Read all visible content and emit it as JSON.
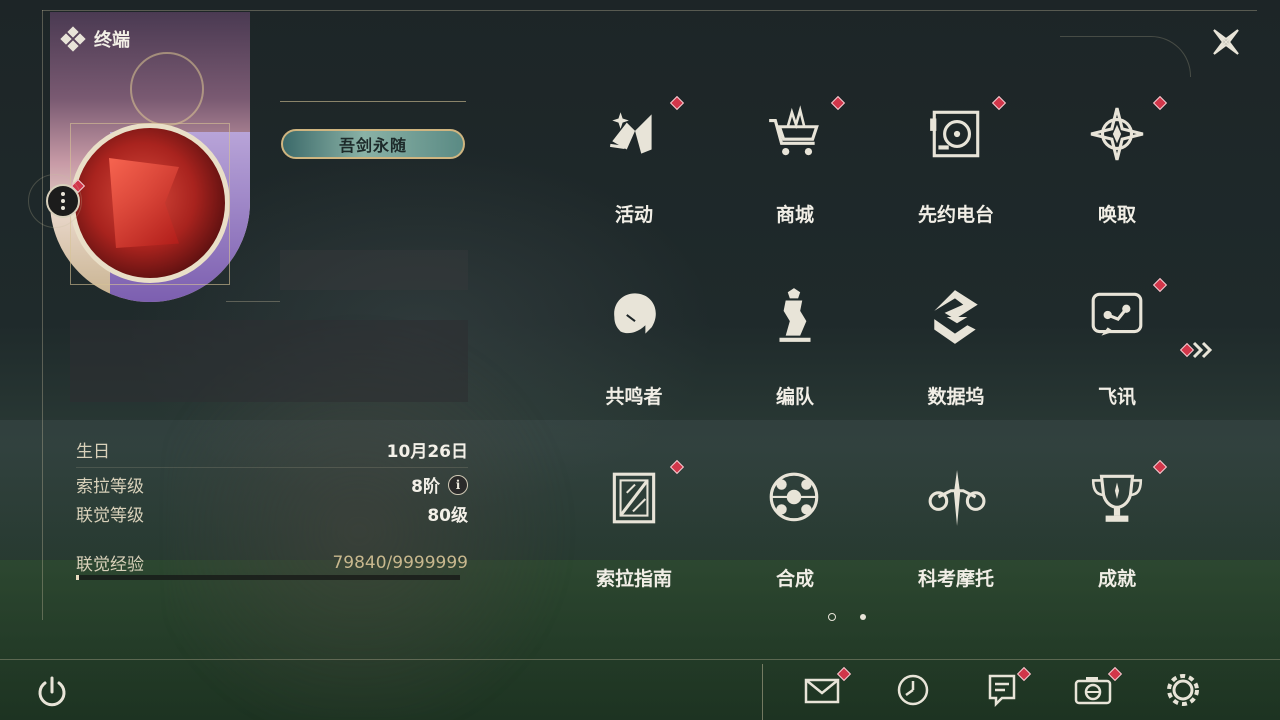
{
  "header": {
    "title": "终端"
  },
  "profile": {
    "title_plate": "吾剑永随"
  },
  "stats": {
    "birthday_label": "生日",
    "birthday_value": "10月26日",
    "sola_level_label": "索拉等级",
    "sola_level_value": "8阶",
    "union_level_label": "联觉等级",
    "union_level_value": "80级",
    "union_exp_label": "联觉经验",
    "union_exp_value": "79840/9999999",
    "union_exp_progress": 0.008
  },
  "menu": {
    "items": [
      {
        "label": "活动",
        "icon": "event-icon",
        "badge": true
      },
      {
        "label": "商城",
        "icon": "shop-icon",
        "badge": true
      },
      {
        "label": "先约电台",
        "icon": "radio-icon",
        "badge": true
      },
      {
        "label": "唤取",
        "icon": "convene-icon",
        "badge": true
      },
      {
        "label": "共鸣者",
        "icon": "resonator-icon",
        "badge": false
      },
      {
        "label": "编队",
        "icon": "team-icon",
        "badge": false
      },
      {
        "label": "数据坞",
        "icon": "data-bank-icon",
        "badge": false
      },
      {
        "label": "飞讯",
        "icon": "message-icon",
        "badge": true
      },
      {
        "label": "索拉指南",
        "icon": "guidebook-icon",
        "badge": true
      },
      {
        "label": "合成",
        "icon": "synthesis-icon",
        "badge": false
      },
      {
        "label": "科考摩托",
        "icon": "motorcycle-icon",
        "badge": false
      },
      {
        "label": "成就",
        "icon": "achievement-icon",
        "badge": true
      }
    ],
    "page": 1,
    "page_count": 2
  },
  "bottom_bar": {
    "icons": [
      "power-icon",
      "mail-icon",
      "clock-icon",
      "notice-icon",
      "camera-icon",
      "settings-icon"
    ]
  },
  "colors": {
    "badge": "#d2364a",
    "text": "#f1eee6",
    "accent_gold": "#cfb580"
  }
}
